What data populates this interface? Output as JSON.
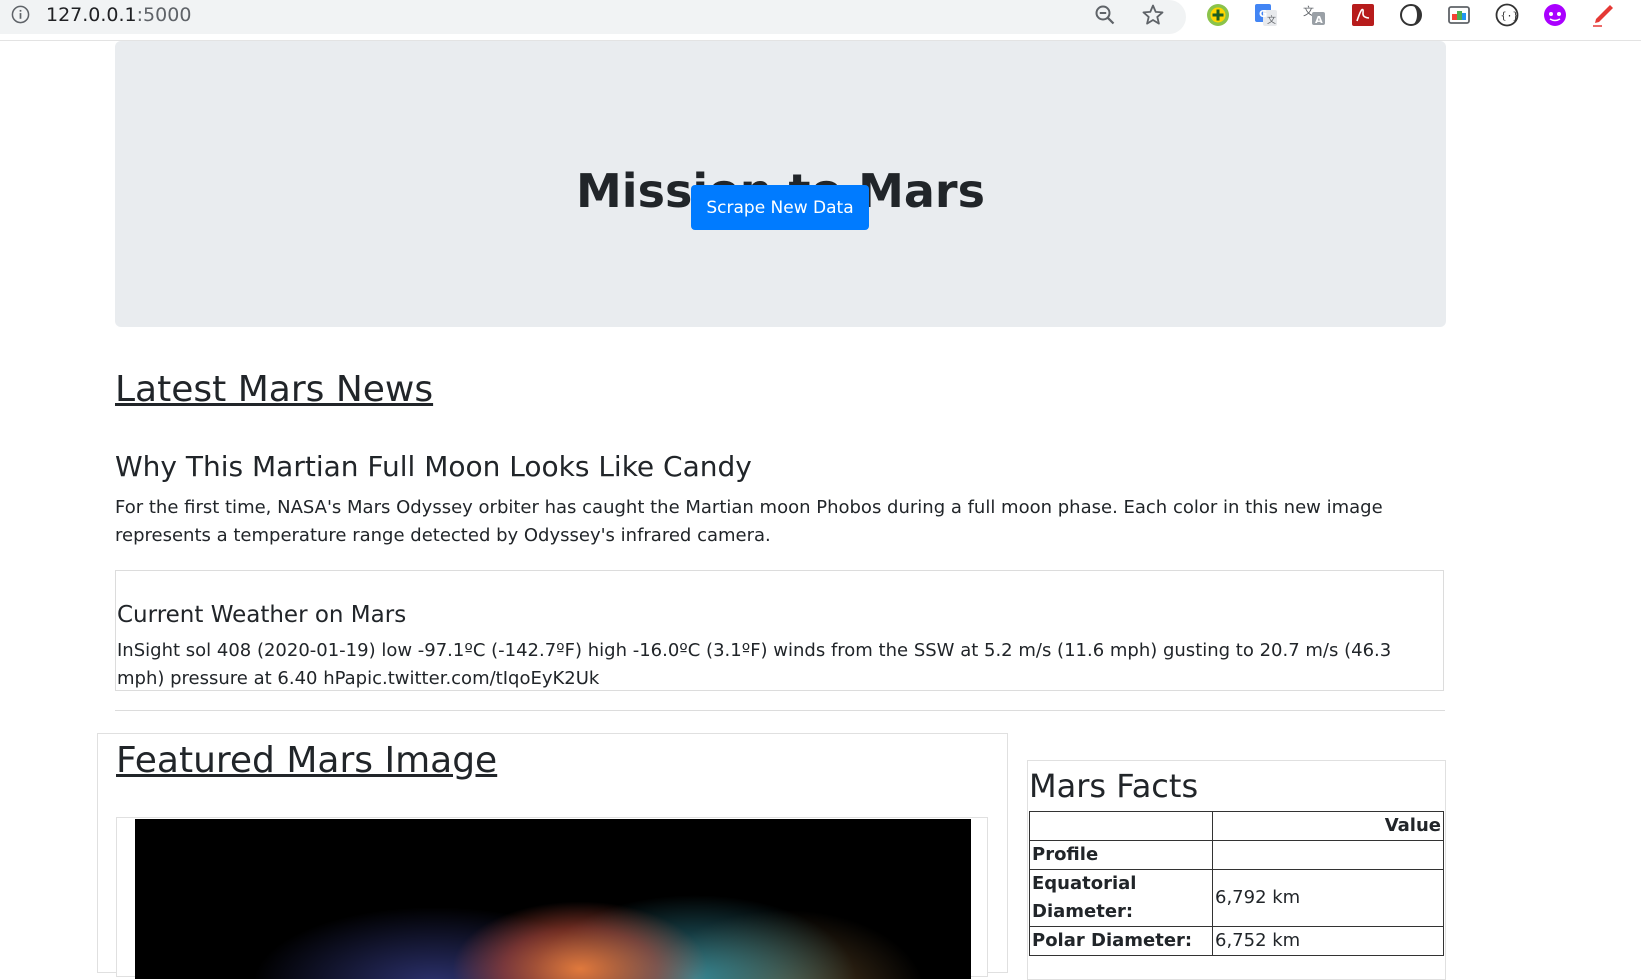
{
  "browser": {
    "url_host": "127.0.0.1",
    "url_port": ":5000",
    "icons": [
      "info-icon",
      "zoom-out-icon",
      "bookmark-star-icon",
      "extension-green-plus-icon",
      "google-translate-icon",
      "translate-icon",
      "pdf-icon",
      "dark-reader-icon",
      "screenshot-icon",
      "json-viewer-icon",
      "purple-extension-icon",
      "red-pen-icon"
    ]
  },
  "hero": {
    "title": "Mission to Mars",
    "button_label": "Scrape New Data",
    "button_color": "#007bff",
    "background_color": "#e9ecef"
  },
  "news": {
    "heading": "Latest Mars News",
    "title": "Why This Martian Full Moon Looks Like Candy",
    "paragraph": "For the first time, NASA's Mars Odyssey orbiter has caught the Martian moon Phobos during a full moon phase. Each color in this new image represents a temperature range detected by Odyssey's infrared camera."
  },
  "weather": {
    "heading": "Current Weather on Mars",
    "text": "InSight sol 408 (2020-01-19) low -97.1ºC (-142.7ºF) high -16.0ºC (3.1ºF) winds from the SSW at 5.2 m/s (11.6 mph) gusting to 20.7 m/s (46.3 mph) pressure at 6.40 hPapic.twitter.com/tIqoEyK2Uk"
  },
  "featured": {
    "heading": "Featured Mars Image"
  },
  "facts": {
    "heading": "Mars Facts",
    "columns": [
      "",
      "Value"
    ],
    "rows": [
      {
        "label": "Profile",
        "value": ""
      },
      {
        "label": "Equatorial Diameter:",
        "value": "6,792 km"
      },
      {
        "label": "Polar Diameter:",
        "value": "6,752 km"
      }
    ]
  }
}
